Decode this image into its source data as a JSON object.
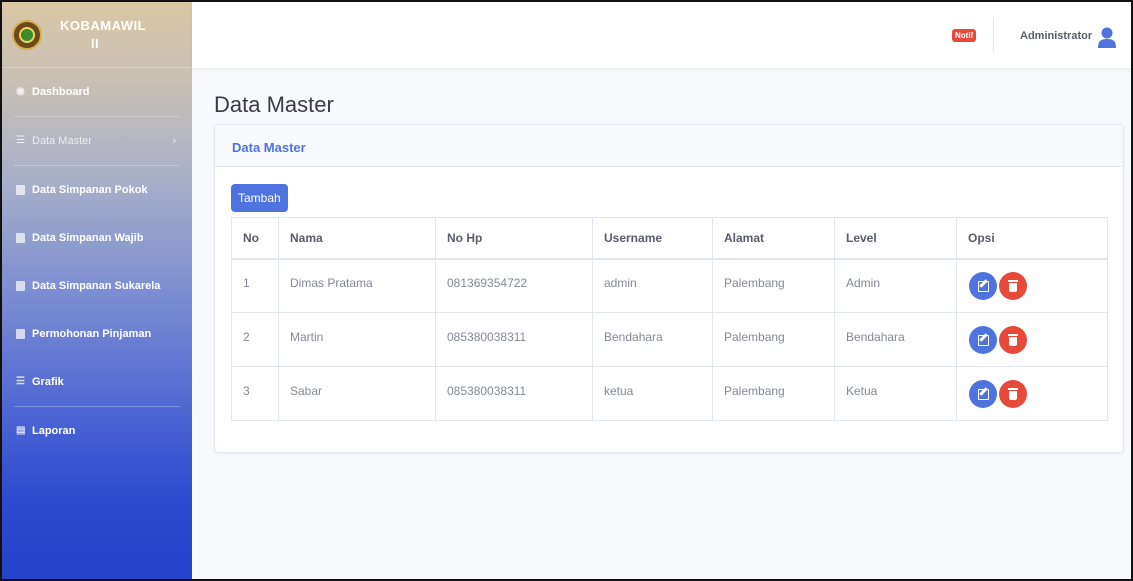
{
  "brand": {
    "line1": "KOBAMAWIL",
    "line2": "II"
  },
  "sidebar": {
    "items": [
      {
        "label": "Dashboard",
        "icon": "dashboard-icon"
      },
      {
        "label": "Data Master",
        "icon": "list-icon"
      },
      {
        "label": "Data Simpanan Pokok",
        "icon": "file-icon"
      },
      {
        "label": "Data Simpanan Wajib",
        "icon": "file-icon"
      },
      {
        "label": "Data Simpanan Sukarela",
        "icon": "file-icon"
      },
      {
        "label": "Permohonan Pinjaman",
        "icon": "file-icon"
      },
      {
        "label": "Grafik",
        "icon": "list-icon"
      },
      {
        "label": "Laporan",
        "icon": "report-icon"
      }
    ]
  },
  "topbar": {
    "notif": "Notif",
    "user": "Administrator"
  },
  "page": {
    "title": "Data Master"
  },
  "card": {
    "header": "Data Master",
    "add_button": "Tambah"
  },
  "table": {
    "headers": [
      "No",
      "Nama",
      "No Hp",
      "Username",
      "Alamat",
      "Level",
      "Opsi"
    ],
    "rows": [
      [
        "1",
        "Dimas Pratama",
        "081369354722",
        "admin",
        "Palembang",
        "Admin"
      ],
      [
        "2",
        "Martin",
        "085380038311",
        "Bendahara",
        "Palembang",
        "Bendahara"
      ],
      [
        "3",
        "Sabar",
        "085380038311",
        "ketua",
        "Palembang",
        "Ketua"
      ]
    ]
  },
  "colors": {
    "primary": "#4e73df",
    "danger": "#e74a3b"
  }
}
